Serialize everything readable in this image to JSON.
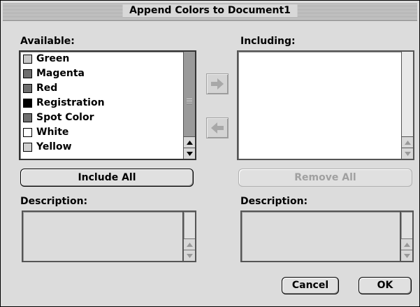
{
  "window": {
    "title": "Append Colors to Document1"
  },
  "available": {
    "label": "Available:",
    "items": [
      {
        "name": "Green",
        "swatch": "#c8c8c8"
      },
      {
        "name": "Magenta",
        "swatch": "#6e6e6e"
      },
      {
        "name": "Red",
        "swatch": "#6e6e6e"
      },
      {
        "name": "Registration",
        "swatch": "#000000"
      },
      {
        "name": "Spot Color",
        "swatch": "#6e6e6e"
      },
      {
        "name": "White",
        "swatch": "#ffffff"
      },
      {
        "name": "Yellow",
        "swatch": "#d0d0d0"
      }
    ],
    "include_all_label": "Include All",
    "description_label": "Description:"
  },
  "including": {
    "label": "Including:",
    "items": [],
    "remove_all_label": "Remove All",
    "description_label": "Description:"
  },
  "transfer": {
    "add_icon": "arrow-right-icon",
    "remove_icon": "arrow-left-icon"
  },
  "actions": {
    "cancel_label": "Cancel",
    "ok_label": "OK"
  }
}
